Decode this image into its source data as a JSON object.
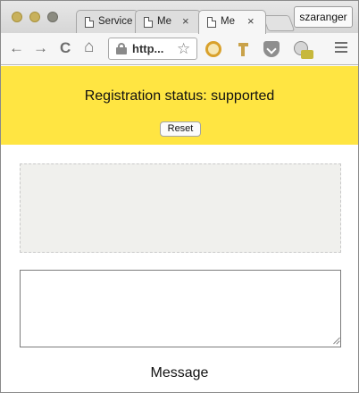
{
  "browser": {
    "tabs": [
      {
        "title": "Service"
      },
      {
        "title": "Me",
        "close": "×"
      },
      {
        "title": "Me",
        "close": "×"
      }
    ],
    "profile_name": "szaranger",
    "url": "http...",
    "bookmark_icon": "☆",
    "back_icon": "←",
    "forward_icon": "→",
    "reload_icon": "C",
    "home_icon": "⌂"
  },
  "page": {
    "status_text": "Registration status: supported",
    "reset_label": "Reset",
    "message_label": "Message",
    "colors": {
      "banner": "#ffe542",
      "output_box": "#f0f0ed"
    }
  }
}
